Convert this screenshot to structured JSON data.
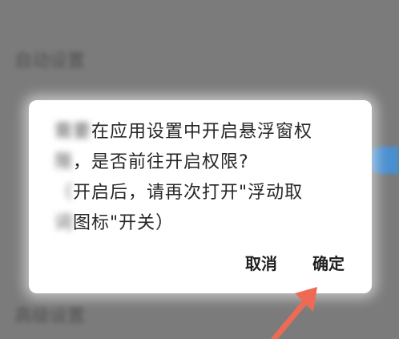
{
  "background": {
    "text_top": "自动设置",
    "text_bottom": "高级设置"
  },
  "dialog": {
    "message_line1_blurred": "需要",
    "message_line1": "在应用设置中开启悬浮窗权",
    "message_line2_blurred": "限",
    "message_line2": "，是否前往开启权限?",
    "message_line3_blurred": "（",
    "message_line3": "开启后，请再次打开\"浮动取",
    "message_line4_blurred": "词",
    "message_line4": "图标\"开关）",
    "cancel_label": "取消",
    "confirm_label": "确定"
  },
  "colors": {
    "arrow": "#ef6a55",
    "toggle_accent": "#4a8fcf"
  }
}
